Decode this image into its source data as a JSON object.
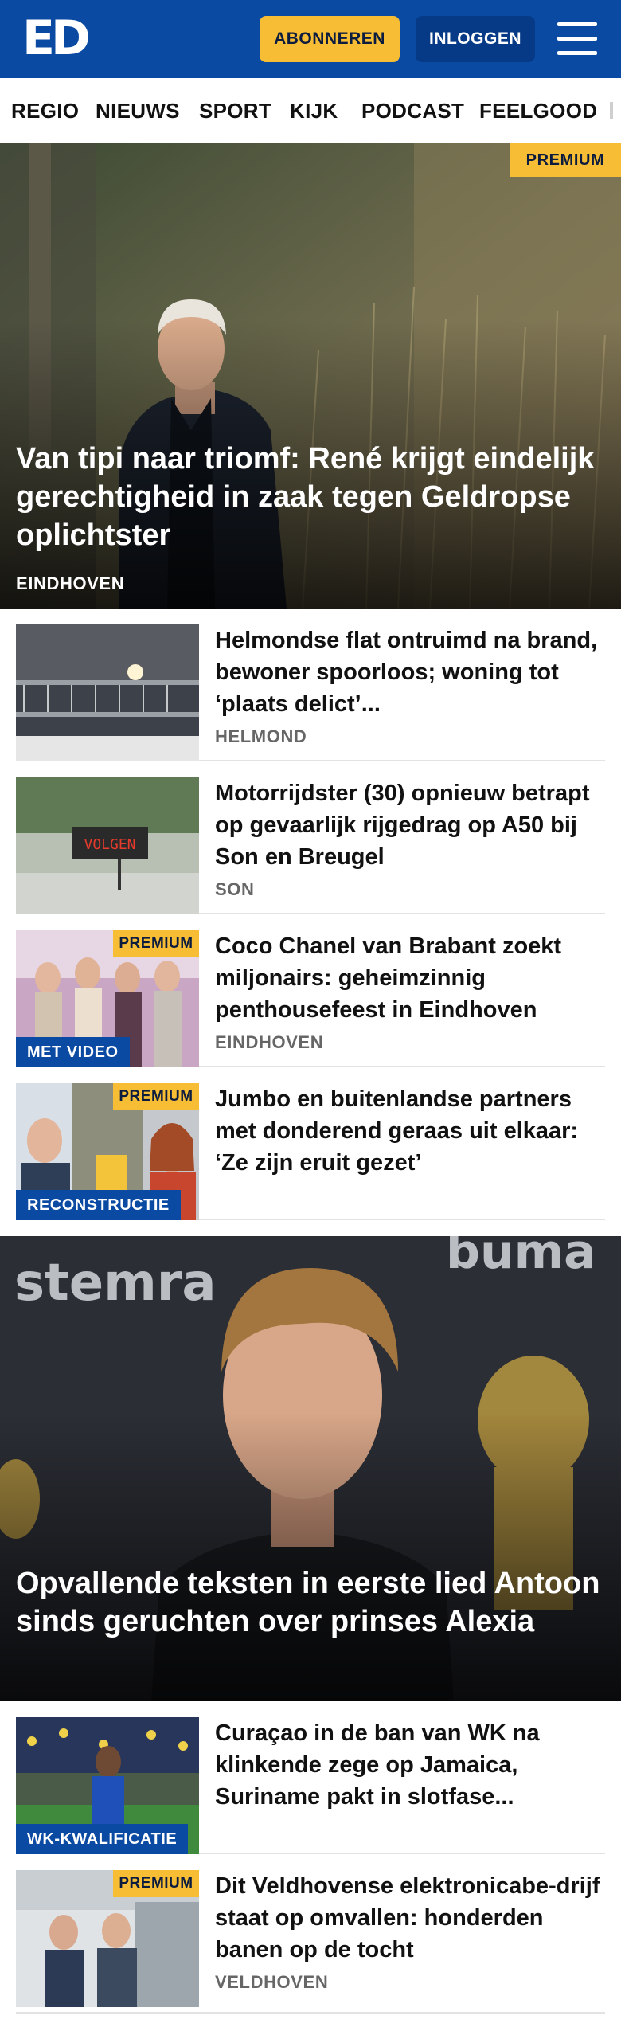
{
  "header": {
    "logo": "ED",
    "subscribe_label": "ABONNEREN",
    "login_label": "INLOGGEN",
    "menu_icon": "hamburger-menu-icon"
  },
  "nav": {
    "items": [
      "REGIO",
      "NIEUWS",
      "SPORT",
      "KIJK",
      "PODCAST",
      "FEELGOOD"
    ]
  },
  "hero1": {
    "badge": "PREMIUM",
    "title": "Van tipi naar triomf: René krijgt eindelijk gerechtigheid in zaak tegen Geldropse oplichtster",
    "location": "EINDHOVEN"
  },
  "articles1": [
    {
      "title": "Helmondse flat ontruimd na brand, bewoner spoorloos; woning tot ‘plaats delict’...",
      "location": "HELMOND"
    },
    {
      "title": "Motorrijdster (30) opnieuw betrapt op gevaarlijk rijgedrag op A50 bij Son en Breugel",
      "location": "SON",
      "sign_text": "VOLGEN"
    },
    {
      "title": "Coco Chanel van Brabant zoekt miljonairs: geheimzinnig penthousefeest in Eindhoven",
      "location": "EINDHOVEN",
      "badge": "PREMIUM",
      "label": "MET VIDEO"
    },
    {
      "title": "Jumbo en buitenlandse partners met donderend geraas uit elkaar: ‘Ze zijn eruit gezet’",
      "badge": "PREMIUM",
      "label": "RECONSTRUCTIE"
    }
  ],
  "hero2": {
    "title": "Opvallende teksten in eerste lied Antoon sinds geruchten over prinses Alexia",
    "backdrop_text_left": "stemra",
    "backdrop_text_right": "buma"
  },
  "articles2": [
    {
      "title": "Curaçao in de ban van WK na klinkende zege op Jamaica, Suriname pakt in slotfase...",
      "label": "WK-KWALIFICATIE"
    },
    {
      "title": "Dit Veldhovense elektronicabe-drijf staat op omvallen: honderden banen op de tocht",
      "location": "VELDHOVEN",
      "badge": "PREMIUM"
    }
  ],
  "colors": {
    "brand_blue": "#0b4aa3",
    "premium_yellow": "#f6bd35",
    "dark_button": "#063a86"
  }
}
